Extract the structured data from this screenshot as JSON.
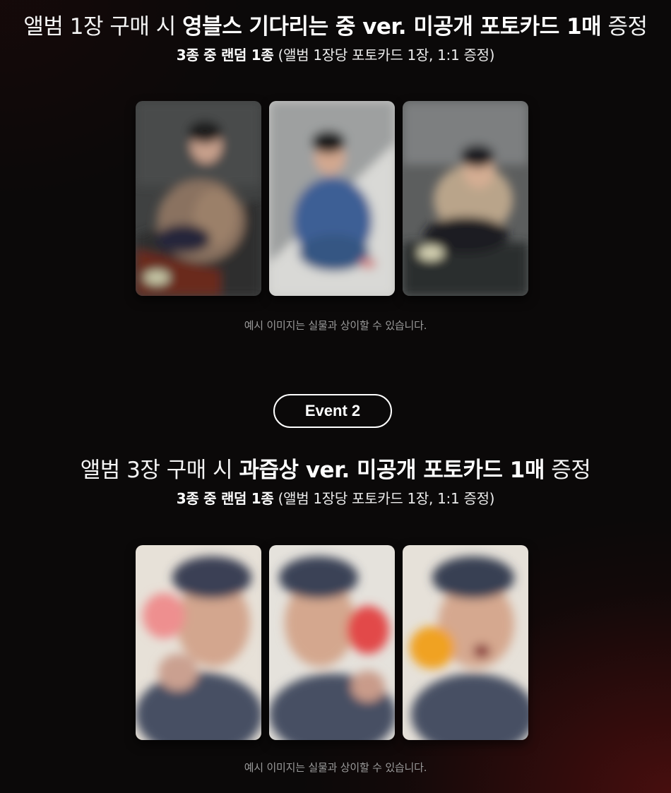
{
  "event1": {
    "title_prefix": "앨범 1장 구매 시 ",
    "title_bold": "영블스 기다리는 중 ver. 미공개 포토카드 1매",
    "title_suffix": " 증정",
    "subtitle_bold": "3종 중 랜덤 1종",
    "subtitle_rest": " (앨범 1장당 포토카드 1장, 1:1 증정)",
    "note": "예시 이미지는 실물과 상이할 수 있습니다."
  },
  "event2": {
    "badge": "Event 2",
    "title_prefix": "앨범 3장 구매 시 ",
    "title_bold": "과즙상 ver. 미공개 포토카드 1매",
    "title_suffix": " 증정",
    "subtitle_bold": "3종 중 랜덤 1종",
    "subtitle_rest": " (앨범 1장당 포토카드 1장, 1:1 증정)",
    "note": "예시 이미지는 실물과 상이할 수 있습니다."
  },
  "colors": {
    "background": "#0b0909",
    "accent_glow": "#781212",
    "note_text": "#9a9a9a"
  }
}
